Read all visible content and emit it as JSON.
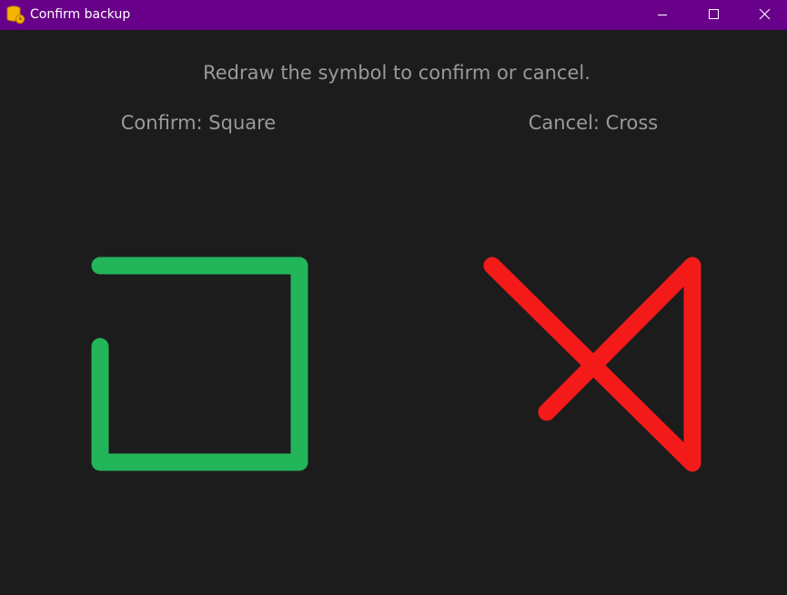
{
  "window": {
    "title": "Confirm backup",
    "titlebar_color": "#68008a",
    "icon": "coins-icon",
    "controls": {
      "minimize": "minimize-icon",
      "maximize": "maximize-icon",
      "close": "close-icon"
    }
  },
  "main": {
    "instruction": "Redraw the symbol to confirm or cancel.",
    "confirm": {
      "label": "Confirm: Square",
      "symbol": "square",
      "color": "#22b55a"
    },
    "cancel": {
      "label": "Cancel: Cross",
      "symbol": "cross",
      "color": "#f51a1a"
    }
  },
  "colors": {
    "background": "#1c1c1c",
    "text": "#9a9a9a"
  }
}
